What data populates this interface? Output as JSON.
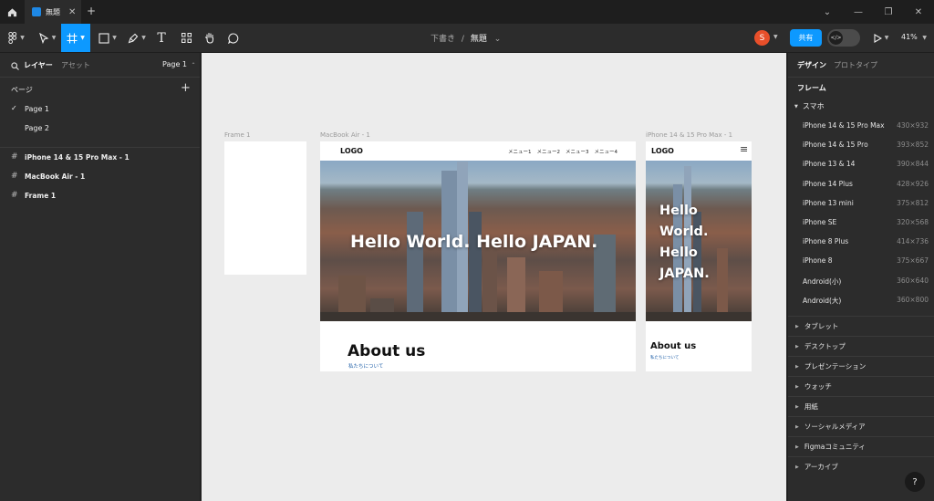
{
  "titlebar": {
    "tab_label": "無題",
    "close_glyph": "✕",
    "new_tab_glyph": "+",
    "chevron_glyph": "⌄",
    "minimize_glyph": "—",
    "restore_glyph": "❐",
    "win_close_glyph": "✕"
  },
  "toolbar": {
    "draft": "下書き",
    "separator": "/",
    "file_name": "無題",
    "title_caret": "⌄",
    "avatar_initial": "S",
    "share_label": "共有",
    "dev_mode_glyph": "</>",
    "zoom": "41%",
    "text_tool_glyph": "T"
  },
  "left_panel": {
    "layers_tab": "レイヤー",
    "assets_tab": "アセット",
    "page_selector": "Page 1",
    "pages_header": "ページ",
    "add_glyph": "+",
    "pages": [
      {
        "label": "Page 1",
        "check": "✓"
      },
      {
        "label": "Page 2"
      }
    ],
    "layers": [
      {
        "label": "iPhone 14 & 15 Pro Max - 1"
      },
      {
        "label": "MacBook Air - 1"
      },
      {
        "label": "Frame 1"
      }
    ],
    "hash_glyph": "#"
  },
  "canvas": {
    "frame1_label": "Frame 1",
    "macbook_label": "MacBook Air - 1",
    "iphone_label": "iPhone 14 & 15 Pro Max - 1",
    "macbook": {
      "logo": "LOGO",
      "menu": [
        "メニュー1",
        "メニュー2",
        "メニュー3",
        "メニュー4"
      ],
      "hero": "Hello World. Hello JAPAN.",
      "about_title": "About us",
      "about_sub": "私たちについて"
    },
    "iphone": {
      "logo": "LOGO",
      "hamburger": "≡",
      "hero_lines": [
        "Hello",
        "World.",
        "Hello",
        "JAPAN."
      ],
      "about_title": "About us",
      "about_sub": "私たちについて"
    }
  },
  "right_panel": {
    "design_tab": "デザイン",
    "prototype_tab": "プロトタイプ",
    "frame_header": "フレーム",
    "phone_group": "スマホ",
    "presets": [
      {
        "name": "iPhone 14 & 15 Pro Max",
        "size": "430×932"
      },
      {
        "name": "iPhone 14 & 15 Pro",
        "size": "393×852"
      },
      {
        "name": "iPhone 13 & 14",
        "size": "390×844"
      },
      {
        "name": "iPhone 14 Plus",
        "size": "428×926"
      },
      {
        "name": "iPhone 13 mini",
        "size": "375×812"
      },
      {
        "name": "iPhone SE",
        "size": "320×568"
      },
      {
        "name": "iPhone 8 Plus",
        "size": "414×736"
      },
      {
        "name": "iPhone 8",
        "size": "375×667"
      },
      {
        "name": "Android(小)",
        "size": "360×640"
      },
      {
        "name": "Android(大)",
        "size": "360×800"
      }
    ],
    "categories": [
      "タブレット",
      "デスクトップ",
      "プレゼンテーション",
      "ウォッチ",
      "用紙",
      "ソーシャルメディア",
      "Figmaコミュニティ",
      "アーカイブ"
    ],
    "collapsed_glyph": "▶",
    "expanded_glyph": "▼"
  },
  "help_glyph": "?"
}
